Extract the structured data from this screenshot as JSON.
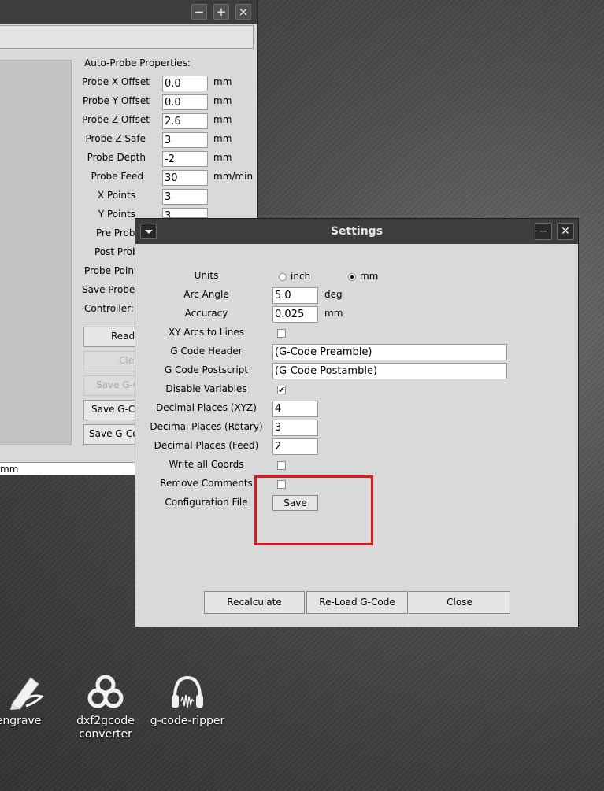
{
  "back_window": {
    "window_controls": {
      "minimize": "−",
      "maximize": "+",
      "close": "×"
    },
    "heading": "Auto-Probe Properties:",
    "properties": [
      {
        "label": "Probe X Offset",
        "value": "0.0",
        "unit": "mm"
      },
      {
        "label": "Probe Y Offset",
        "value": "0.0",
        "unit": "mm"
      },
      {
        "label": "Probe Z Offset",
        "value": "2.6",
        "unit": "mm"
      },
      {
        "label": "Probe Z Safe",
        "value": "3",
        "unit": "mm"
      },
      {
        "label": "Probe Depth",
        "value": "-2",
        "unit": "mm"
      },
      {
        "label": "Probe Feed",
        "value": "30",
        "unit": "mm/min"
      },
      {
        "label": "X Points",
        "value": "3"
      },
      {
        "label": "Y Points",
        "value": "3"
      },
      {
        "label": "Pre Probe"
      },
      {
        "label": "Post Probe"
      },
      {
        "label": "Probe Point"
      },
      {
        "label": "Save Probe"
      },
      {
        "label": "Controller:"
      }
    ],
    "buttons": [
      {
        "label": "Read",
        "enabled": true
      },
      {
        "label": "Cle",
        "enabled": false
      },
      {
        "label": "Save G-C",
        "enabled": false
      },
      {
        "label": "Save G-Co",
        "enabled": true
      },
      {
        "label": "Save G-Co",
        "enabled": true
      }
    ],
    "status_text": "mm"
  },
  "settings_dialog": {
    "title": "Settings",
    "window_controls": {
      "minimize": "−",
      "close": "✕"
    },
    "units": {
      "label": "Units",
      "options": [
        {
          "label": "inch",
          "selected": false
        },
        {
          "label": "mm",
          "selected": true
        }
      ]
    },
    "arc_angle": {
      "label": "Arc Angle",
      "value": "5.0",
      "unit": "deg"
    },
    "accuracy": {
      "label": "Accuracy",
      "value": "0.025",
      "unit": "mm"
    },
    "xy_arcs_to_lines": {
      "label": "XY Arcs to Lines",
      "checked": false
    },
    "gcode_header": {
      "label": "G Code Header",
      "value": "(G-Code Preamble)"
    },
    "gcode_postscript": {
      "label": "G Code Postscript",
      "value": "(G-Code Postamble)"
    },
    "disable_variables": {
      "label": "Disable Variables",
      "checked": true
    },
    "decimal_xyz": {
      "label": "Decimal Places (XYZ)",
      "value": "4"
    },
    "decimal_rotary": {
      "label": "Decimal Places (Rotary)",
      "value": "3"
    },
    "decimal_feed": {
      "label": "Decimal Places (Feed)",
      "value": "2"
    },
    "write_all_coords": {
      "label": "Write all Coords",
      "checked": false
    },
    "remove_comments": {
      "label": "Remove Comments",
      "checked": false
    },
    "config_file": {
      "label": "Configuration File",
      "button": "Save"
    },
    "bottom_buttons": {
      "recalculate": "Recalculate",
      "reload": "Re-Load G-Code",
      "close": "Close"
    },
    "highlight_color": "#e5161b"
  },
  "desktop_icons": [
    {
      "label": "f-engrave",
      "icon": "pen-feather-icon"
    },
    {
      "label": "dxf2gcode",
      "label2": "converter",
      "icon": "trefoil-icon"
    },
    {
      "label": "g-code-ripper",
      "icon": "headphones-icon"
    }
  ]
}
